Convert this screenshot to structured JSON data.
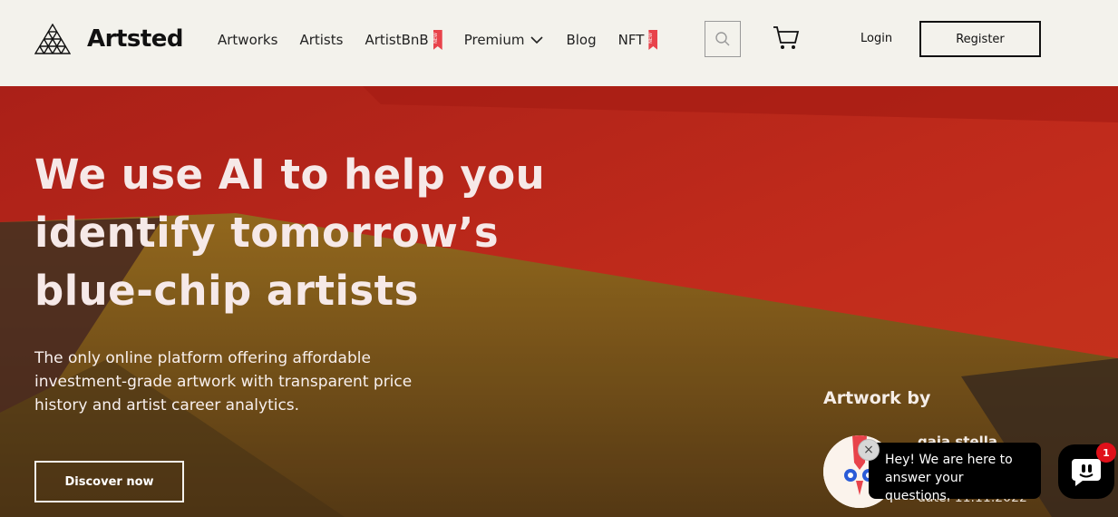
{
  "brand": {
    "name": "Artsted",
    "icon": "triangle-grid-logo-icon"
  },
  "nav": {
    "items": [
      {
        "label": "Artworks"
      },
      {
        "label": "Artists"
      },
      {
        "label": "ArtistBnB",
        "badge": "NEW"
      },
      {
        "label": "Premium"
      },
      {
        "label": "Blog"
      },
      {
        "label": "NFT",
        "badge": "NEW"
      }
    ]
  },
  "header": {
    "search_icon": "search-icon",
    "cart_icon": "cart-icon",
    "login_label": "Login",
    "register_label": "Register"
  },
  "hero": {
    "title_line1": "We use AI to help you",
    "title_line2": "identify tomorrow’s",
    "title_line3": "blue-chip artists",
    "subtitle": "The only online platform offering affordable investment-grade artwork with transparent price history and artist career analytics.",
    "cta_label": "Discover now",
    "artwork_by_label": "Artwork by",
    "artist_name": "gaia stella",
    "artist_date": "date: 11.11.2022"
  },
  "chat": {
    "message": "Hey! We are here to answer your questions.",
    "close_label": "×",
    "unread_count": "1"
  },
  "colors": {
    "header_bg": "#f3f2ec",
    "hero_red": "#c2271c",
    "hero_ochre": "#8f6a1c",
    "badge_red": "#e8434b"
  }
}
